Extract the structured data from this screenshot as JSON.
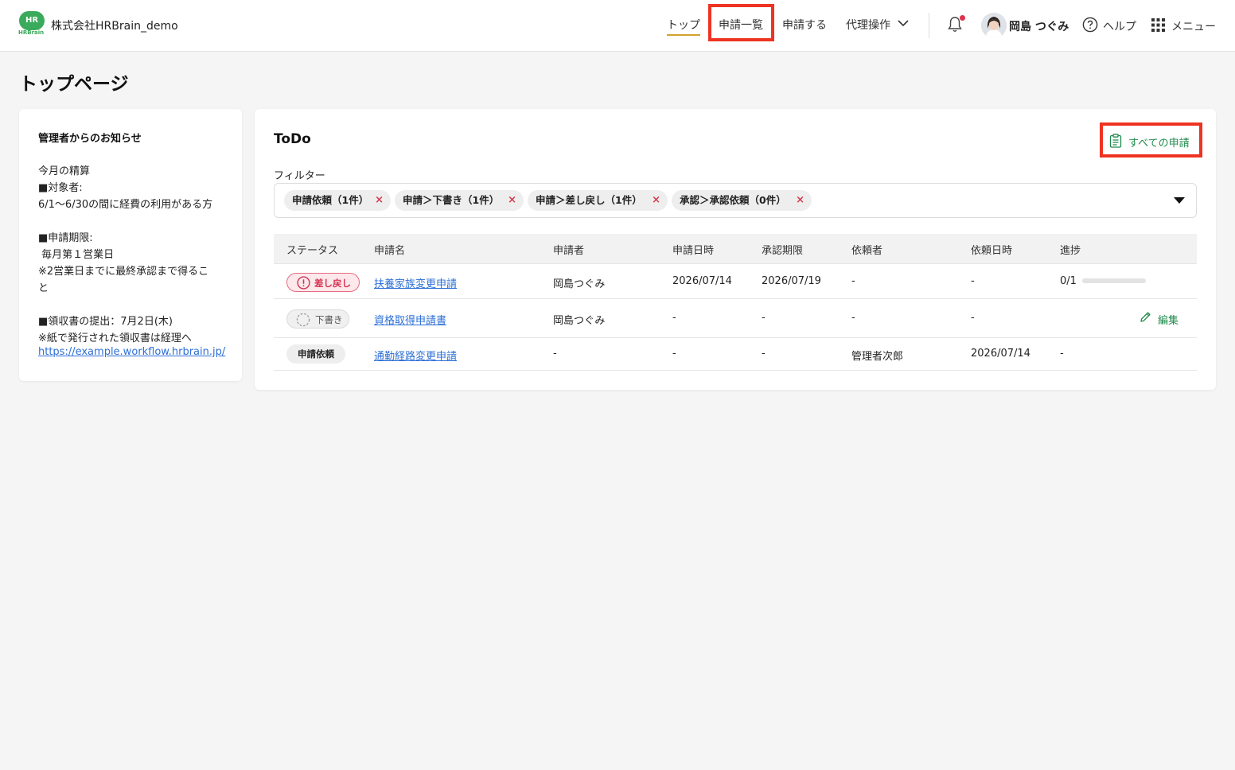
{
  "header": {
    "logo_text": "HR",
    "logo_brand": "HRBrain",
    "company": "株式会社HRBrain_demo",
    "nav": {
      "top": "トップ",
      "list": "申請一覧",
      "apply": "申請する",
      "proxy": "代理操作"
    },
    "user_name": "岡島 つぐみ",
    "help": "ヘルプ",
    "menu": "メニュー",
    "accent_color": "#3aaa5c",
    "highlight_color": "#ee3322"
  },
  "page_title": "トップページ",
  "notice": {
    "title": "管理者からのお知らせ",
    "lines": [
      "今月の精算",
      "■対象者:",
      "6/1〜6/30の間に経費の利用がある方",
      "■申請期限:",
      " 毎月第１営業日",
      "※2営業日までに最終承認まで得るこ",
      "と",
      "■領収書の提出：7月2日(木)",
      "※紙で発行された領収書は経理へ"
    ],
    "link": "https://example.workflow.hrbrain.jp/"
  },
  "todo": {
    "title": "ToDo",
    "all_apps": "すべての申請",
    "filter_label": "フィルター",
    "chips": [
      "申請依頼（1件）",
      "申請＞下書き（1件）",
      "申請＞差し戻し（1件）",
      "承認＞承認依頼（0件）"
    ],
    "chip_remove": "×",
    "columns": [
      "ステータス",
      "申請名",
      "申請者",
      "申請日時",
      "承認期限",
      "依頼者",
      "依頼日時",
      "進捗"
    ],
    "rows": [
      {
        "status": "差し戻し",
        "status_icon": "alert-circle-icon",
        "name": "扶養家族変更申請",
        "applicant": "岡島つぐみ",
        "applied_at": "2026/07/14",
        "deadline": "2026/07/19",
        "requester": "-",
        "requested_at": "-",
        "progress": "0/1",
        "progress_fraction": 0
      },
      {
        "status": "下書き",
        "status_icon": "draft-circle-icon",
        "name": "資格取得申請書",
        "applicant": "岡島つぐみ",
        "applied_at": "-",
        "deadline": "-",
        "requester": "-",
        "requested_at": "-",
        "progress": "",
        "action": "編集"
      },
      {
        "status": "申請依頼",
        "name": "通勤経路変更申請",
        "applicant": "-",
        "applied_at": "-",
        "deadline": "-",
        "requester": "管理者次郎",
        "requested_at": "2026/07/14",
        "progress": "-"
      }
    ],
    "colors": {
      "link": "#2e6fd6",
      "returned": "#d23350",
      "action": "#1f8a4c"
    }
  }
}
